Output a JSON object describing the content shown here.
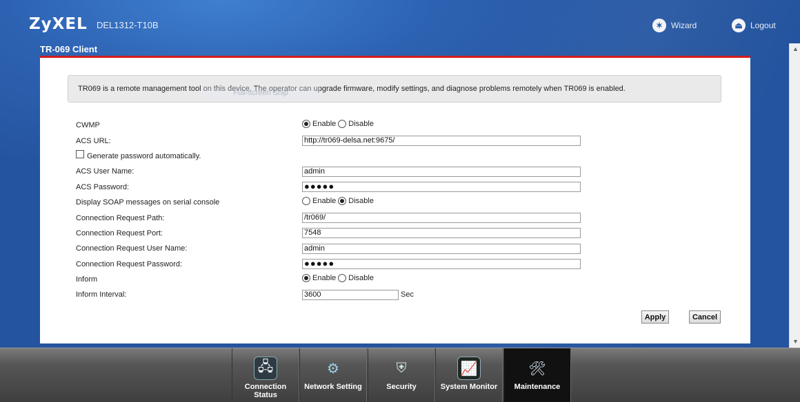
{
  "header": {
    "brand": "ZyXEL",
    "model": "DEL1312-T10B",
    "wizard_label": "Wizard",
    "logout_label": "Logout"
  },
  "page": {
    "title": "TR-069 Client",
    "info": "TR069 is a remote management tool on this device. The operator can upgrade firmware, modify settings, and diagnose problems remotely when TR069 is enabled."
  },
  "tooltip": "Full-screen Snip",
  "form": {
    "cwmp": {
      "label": "CWMP",
      "enable": "Enable",
      "disable": "Disable",
      "value": "Enable"
    },
    "acs_url": {
      "label": "ACS URL:",
      "value": "http://tr069-delsa.net:9675/"
    },
    "gen_password": {
      "label": "Generate password automatically.",
      "checked": false
    },
    "acs_user": {
      "label": "ACS User Name:",
      "value": "admin"
    },
    "acs_password": {
      "label": "ACS Password:",
      "value": "●●●●●"
    },
    "soap": {
      "label": "Display SOAP messages on serial console",
      "enable": "Enable",
      "disable": "Disable",
      "value": "Disable"
    },
    "conn_path": {
      "label": "Connection Request Path:",
      "value": "/tr069/"
    },
    "conn_port": {
      "label": "Connection Request Port:",
      "value": "7548"
    },
    "conn_user": {
      "label": "Connection Request User Name:",
      "value": "admin"
    },
    "conn_password": {
      "label": "Connection Request Password:",
      "value": "●●●●●"
    },
    "inform": {
      "label": "Inform",
      "enable": "Enable",
      "disable": "Disable",
      "value": "Enable"
    },
    "inform_interval": {
      "label": "Inform Interval:",
      "value": "3600",
      "unit": "Sec"
    }
  },
  "buttons": {
    "apply": "Apply",
    "cancel": "Cancel"
  },
  "nav": [
    {
      "label": "Connection Status",
      "icon": "connection-status-icon"
    },
    {
      "label": "Network Setting",
      "icon": "gear-icon"
    },
    {
      "label": "Security",
      "icon": "shield-icon"
    },
    {
      "label": "System Monitor",
      "icon": "monitor-icon"
    },
    {
      "label": "Maintenance",
      "icon": "maintenance-icon",
      "active": true
    }
  ]
}
